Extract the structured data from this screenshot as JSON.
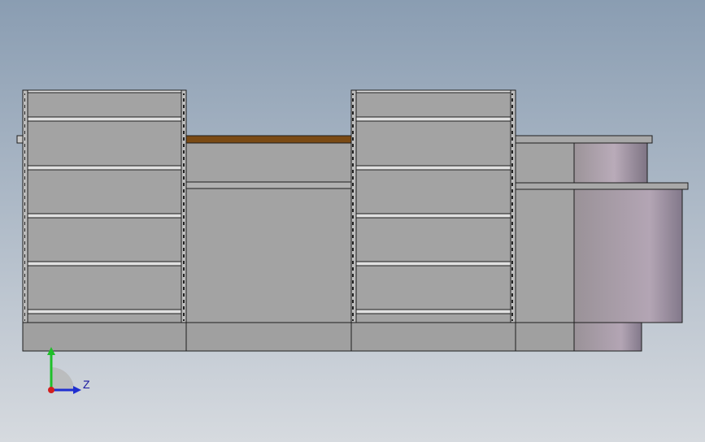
{
  "viewport": {
    "background_top": "#8a9db2",
    "background_bottom": "#d6dadf",
    "model": "shelving-counter-assembly",
    "view": "front"
  },
  "colors": {
    "cabinet_face": "#a3a3a3",
    "shelf_edge": "#e0e0e0",
    "outline": "#1e1e1e",
    "wood_top": "#7a4a14",
    "cylinder_light": "#b8aab8",
    "cylinder_dark": "#857a8a",
    "plinth": "#9c9c9c"
  },
  "triad": {
    "z_label": "Z",
    "y_axis_color": "#1fbf2a",
    "z_axis_color": "#1f2fd0",
    "x_axis_color": "#d21f1f"
  }
}
